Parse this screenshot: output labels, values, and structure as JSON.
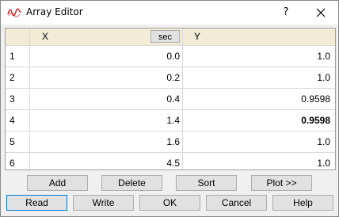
{
  "window": {
    "title": "Array Editor",
    "help_label": "?"
  },
  "table": {
    "col_x": "X",
    "unit_button": "sec",
    "col_y": "Y",
    "rows": [
      {
        "n": "1",
        "x": "0.0",
        "y": "1.0"
      },
      {
        "n": "2",
        "x": "0.2",
        "y": "1.0"
      },
      {
        "n": "3",
        "x": "0.4",
        "y": "0.9598"
      },
      {
        "n": "4",
        "x": "1.4",
        "y": "0.9598"
      },
      {
        "n": "5",
        "x": "1.6",
        "y": "1.0"
      },
      {
        "n": "6",
        "x": "4.5",
        "y": "1.0"
      }
    ]
  },
  "buttons_row1": {
    "add": "Add",
    "delete": "Delete",
    "sort": "Sort",
    "plot": "Plot  >>"
  },
  "buttons_row2": {
    "read": "Read",
    "write": "Write",
    "ok": "OK",
    "cancel": "Cancel",
    "help": "Help"
  },
  "colors": {
    "header_bg": "#f2ecd7",
    "focus_border": "#0078d7",
    "icon_red": "#cc2222"
  }
}
